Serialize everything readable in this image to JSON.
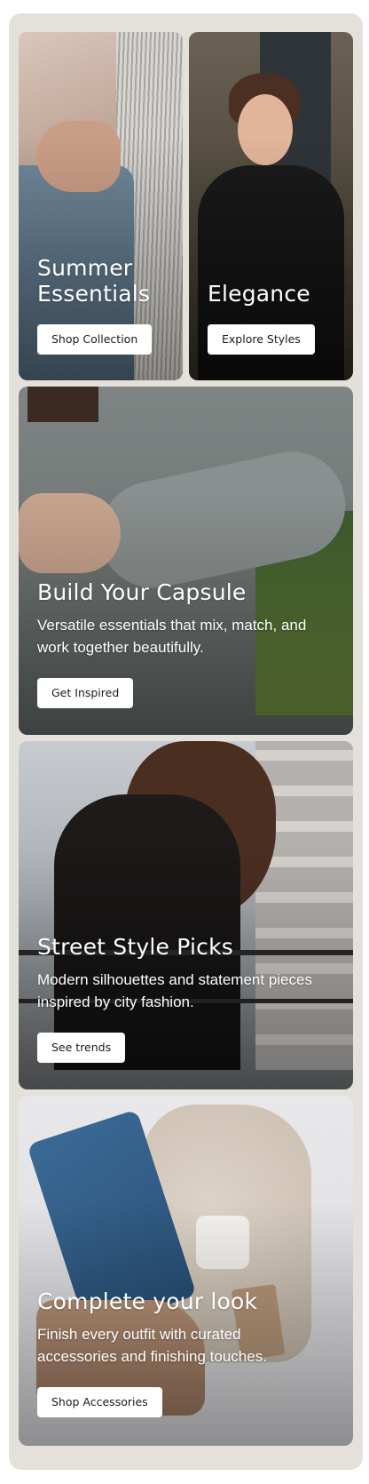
{
  "cards": [
    {
      "title": "Summer\nEssentials",
      "button": "Shop Collection"
    },
    {
      "title": "Elegance",
      "button": "Explore Styles"
    },
    {
      "title": "Build Your Capsule",
      "description": "Versatile essentials that mix, match, and work together beautifully.",
      "button": "Get Inspired"
    },
    {
      "title": "Street Style Picks",
      "description": "Modern silhouettes and statement pieces inspired by city fashion.",
      "button": "See trends"
    },
    {
      "title": "Complete your look",
      "description": "Finish every outfit with curated accessories and finishing touches.",
      "button": "Shop Accessories"
    }
  ]
}
